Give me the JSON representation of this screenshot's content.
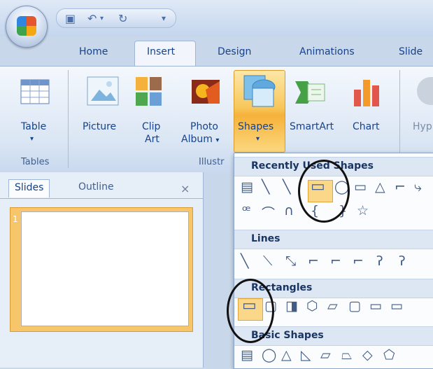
{
  "tabs": [
    "Home",
    "Insert",
    "Design",
    "Animations",
    "Slide"
  ],
  "ribbon": {
    "buttons": {
      "table": "Table",
      "picture": "Picture",
      "clip_art_1": "Clip",
      "clip_art_2": "Art",
      "photo_album_1": "Photo",
      "photo_album_2": "Album",
      "shapes": "Shapes",
      "smartart": "SmartArt",
      "chart": "Chart",
      "hyperlink": "Hyp"
    },
    "groups": {
      "tables": "Tables",
      "illustrations": "Illustr"
    }
  },
  "pane": {
    "tab_slides": "Slides",
    "tab_outline": "Outline",
    "close": "×",
    "slide_number": "1"
  },
  "gallery": {
    "sections": [
      "Recently Used Shapes",
      "Lines",
      "Rectangles",
      "Basic Shapes"
    ],
    "rows": {
      "recent_1": [
        "▤",
        "╲",
        "╲",
        "▭",
        "◯",
        "▭",
        "△",
        "⌐",
        "⤷"
      ],
      "recent_2": [
        "ꟹ",
        "⌒",
        "∩",
        "{",
        "}",
        "☆"
      ],
      "lines": [
        "╲",
        "⟍",
        "⤡",
        "⌐",
        "⌐",
        "⌐",
        "ʔ",
        "ʔ"
      ],
      "rectangles": [
        "▭",
        "▢",
        "◨",
        "⬡",
        "▱",
        "▢",
        "▭",
        "▭"
      ],
      "basic": [
        "▤",
        "◯",
        "△",
        "◺",
        "▱",
        "⏢",
        "◇",
        "⬠"
      ]
    }
  },
  "colors": {
    "ribbon_bg": "#dbe6f4",
    "accent_orange": "#f6b23b",
    "text_blue": "#15428b"
  }
}
